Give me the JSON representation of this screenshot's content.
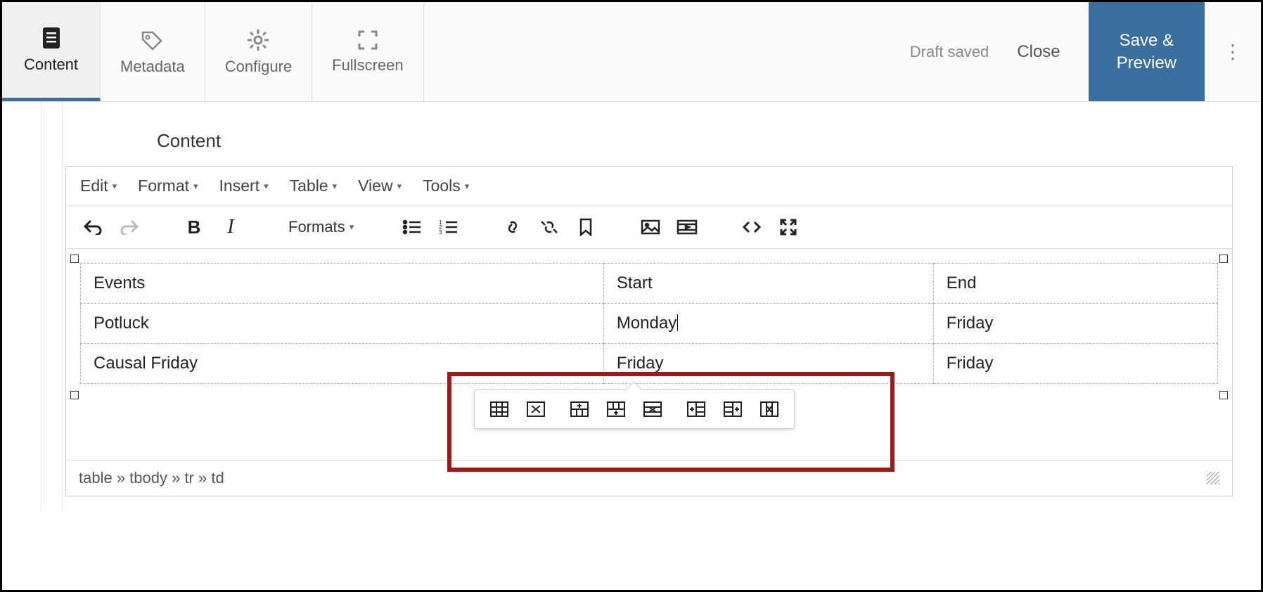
{
  "header": {
    "tabs": [
      {
        "label": "Content",
        "icon": "document"
      },
      {
        "label": "Metadata",
        "icon": "tag"
      },
      {
        "label": "Configure",
        "icon": "gear"
      },
      {
        "label": "Fullscreen",
        "icon": "fullscreen"
      }
    ],
    "draft_saved": "Draft saved",
    "close": "Close",
    "save_preview": "Save & Preview"
  },
  "section_title": "Content",
  "editor": {
    "menus": [
      "Edit",
      "Format",
      "Insert",
      "Table",
      "View",
      "Tools"
    ],
    "formats_label": "Formats",
    "table": {
      "headers": [
        "Events",
        "Start",
        "End"
      ],
      "rows": [
        [
          "Potluck",
          "Monday",
          "Friday"
        ],
        [
          "Causal Friday",
          "Friday",
          "Friday"
        ]
      ]
    },
    "path": "table » tbody » tr » td"
  },
  "context_toolbar": {
    "groups": [
      [
        "table-properties",
        "delete-table"
      ],
      [
        "insert-row-before",
        "insert-row-after",
        "delete-row"
      ],
      [
        "insert-col-before",
        "insert-col-after",
        "delete-col"
      ]
    ]
  }
}
